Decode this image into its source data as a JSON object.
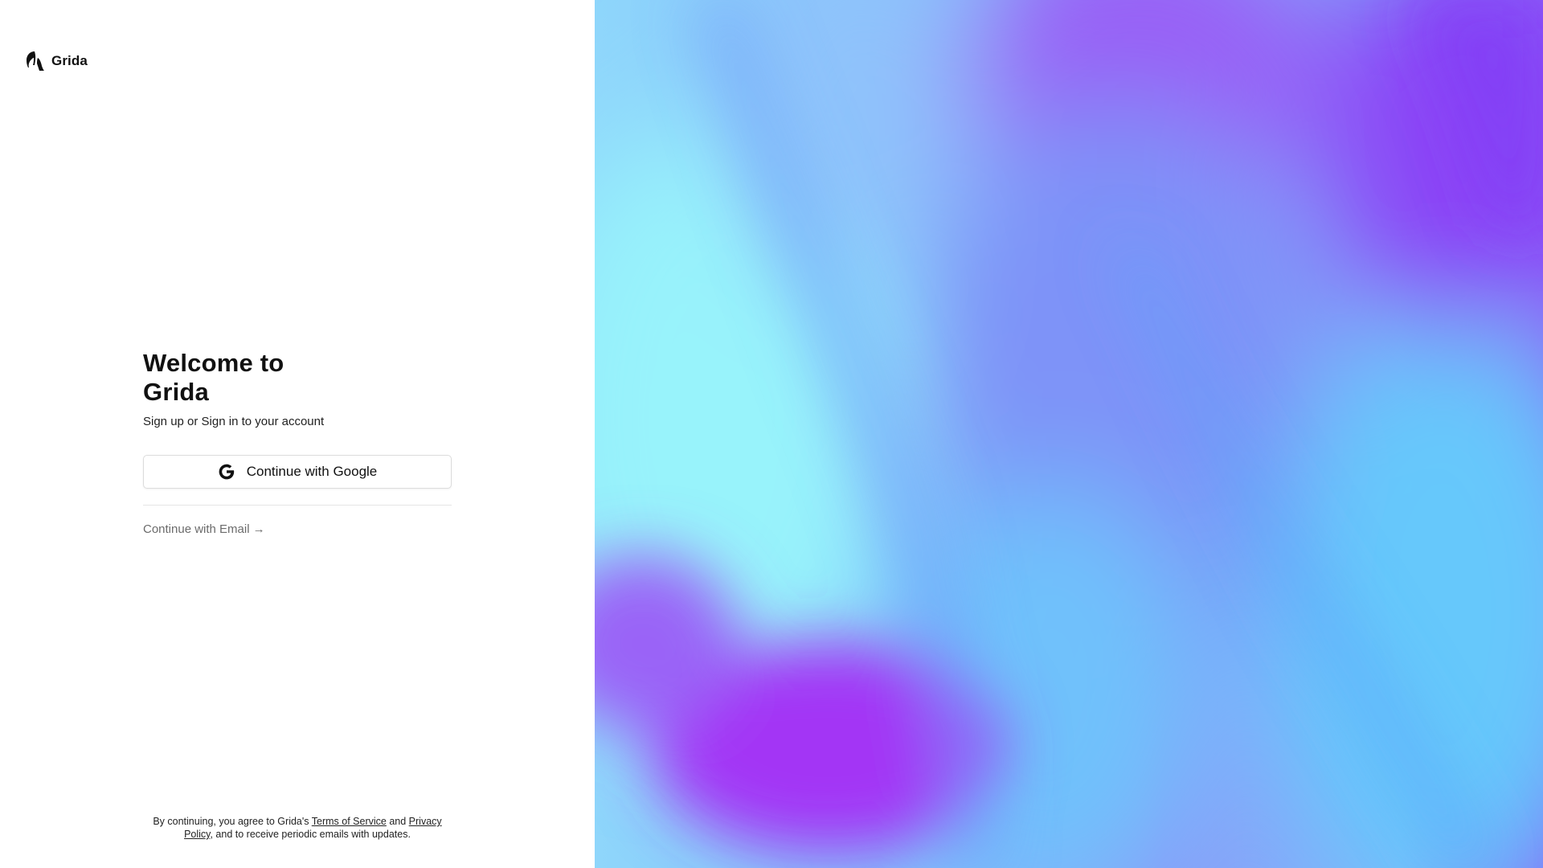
{
  "brand": {
    "name": "Grida",
    "logo_icon": "grida-logo-icon"
  },
  "auth": {
    "title": "Welcome to Grida",
    "subtitle": "Sign up or Sign in to your account",
    "google_button_label": "Continue with Google",
    "google_icon": "google-g-icon",
    "email_link_label": "Continue with Email",
    "email_arrow": "→"
  },
  "legal": {
    "prefix": "By continuing, you agree to Grida's ",
    "terms_link": "Terms of Service",
    "middle": " and ",
    "privacy_link": "Privacy Policy",
    "suffix": ", and to receive periodic emails with updates."
  },
  "hero": {
    "art": "gradient-art",
    "colors": [
      "#98f3fb",
      "#7fc6fb",
      "#6aa6fb",
      "#8a7df9",
      "#a336f5",
      "#66c8fb"
    ]
  }
}
